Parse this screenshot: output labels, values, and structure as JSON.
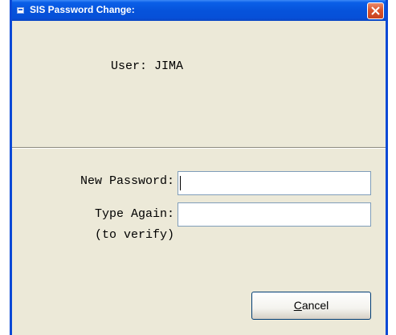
{
  "window": {
    "title": "SIS Password Change:",
    "accent_color": "#0a5fe8",
    "close_color": "#d9542c"
  },
  "user_line": {
    "text": "User: JIMA"
  },
  "form": {
    "new_password_label": "New Password:",
    "new_password_value": "",
    "type_again_label": "Type Again:",
    "type_again_value": "",
    "verify_note": "(to verify)"
  },
  "buttons": {
    "cancel_mnemonic": "C",
    "cancel_rest": "ancel"
  }
}
